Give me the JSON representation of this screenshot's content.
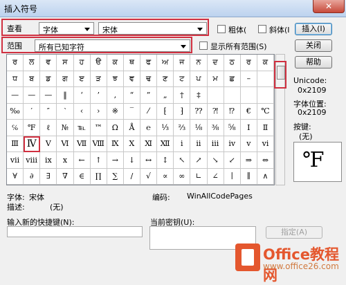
{
  "window": {
    "title": "插入符号",
    "close_glyph": "✕"
  },
  "row1": {
    "look_label": "查看",
    "font_combo": "字体",
    "name_combo": "宋体",
    "bold_label": "粗体(",
    "italic_label": "斜体(I"
  },
  "row2": {
    "range_label": "范围",
    "range_combo": "所有已知字符",
    "show_all_label": "显示所有范围(S)"
  },
  "buttons": {
    "insert": "插入(I)",
    "close": "关闭",
    "help": "帮助",
    "assign": "指定(A)"
  },
  "info": {
    "unicode_label": "Unicode:",
    "unicode_value": "0x2109",
    "fontpos_label": "字体位置:",
    "fontpos_value": "0x2109",
    "key_label": "按键:",
    "key_value": "(无)",
    "preview_char": "℉"
  },
  "bottom": {
    "font_label": "字体:",
    "font_value": "宋体",
    "desc_label": "描述:",
    "desc_value": "(无)",
    "code_label": "编码:",
    "code_value": "WinAllCodePages",
    "shortcut_label": "输入新的快捷键(N):",
    "current_key_label": "当前密钥(U):"
  },
  "grid": {
    "selected": [
      5,
      1
    ],
    "rows": [
      [
        "ਰ",
        "ਲ",
        "ਵ",
        "ਸ",
        "ਹ",
        "ੳ",
        "ਕ",
        "ਥ",
        "ਫ",
        "ਅ",
        "ਜ",
        "ਨ",
        "ਦ",
        "ਠ",
        "ਰ",
        "ਕ"
      ],
      [
        "ਧ",
        "ਬ",
        "ਡ",
        "ਗ",
        "ੲ",
        "ੜ",
        "ਝ",
        "ਞ",
        "ਢ",
        "ਣ",
        "ਟ",
        "ਪ",
        "ਮ",
        "ਛ",
        "–",
        ""
      ],
      [
        "—",
        "—",
        "—",
        "‖",
        "‘",
        "’",
        "‚",
        "“",
        "”",
        "„",
        "†",
        "‡",
        "",
        "",
        "",
        ""
      ],
      [
        "‰",
        "′",
        "″",
        "‵",
        "‹",
        "›",
        "※",
        "‾",
        "⁄",
        "⁅",
        "⁆",
        "⁇",
        "⁈",
        "⁉",
        "€",
        "℃"
      ],
      [
        "℅",
        "℉",
        "ℓ",
        "№",
        "℡",
        "™",
        "Ω",
        "Å",
        "℮",
        "⅓",
        "⅔",
        "⅛",
        "⅜",
        "⅝",
        "Ⅰ",
        "Ⅱ"
      ],
      [
        "Ⅲ",
        "Ⅳ",
        "Ⅴ",
        "Ⅵ",
        "Ⅶ",
        "Ⅷ",
        "Ⅸ",
        "Ⅹ",
        "Ⅺ",
        "Ⅻ",
        "ⅰ",
        "ⅱ",
        "ⅲ",
        "ⅳ",
        "ⅴ",
        "ⅵ"
      ],
      [
        "ⅶ",
        "ⅷ",
        "ⅸ",
        "ⅹ",
        "←",
        "↑",
        "→",
        "↓",
        "↔",
        "↕",
        "↖",
        "↗",
        "↘",
        "↙",
        "⇒",
        "⇔"
      ],
      [
        "∀",
        "∂",
        "∃",
        "∇",
        "∈",
        "∏",
        "∑",
        "∕",
        "√",
        "∝",
        "∞",
        "∟",
        "∠",
        "∣",
        "∥",
        "∧"
      ]
    ]
  }
}
